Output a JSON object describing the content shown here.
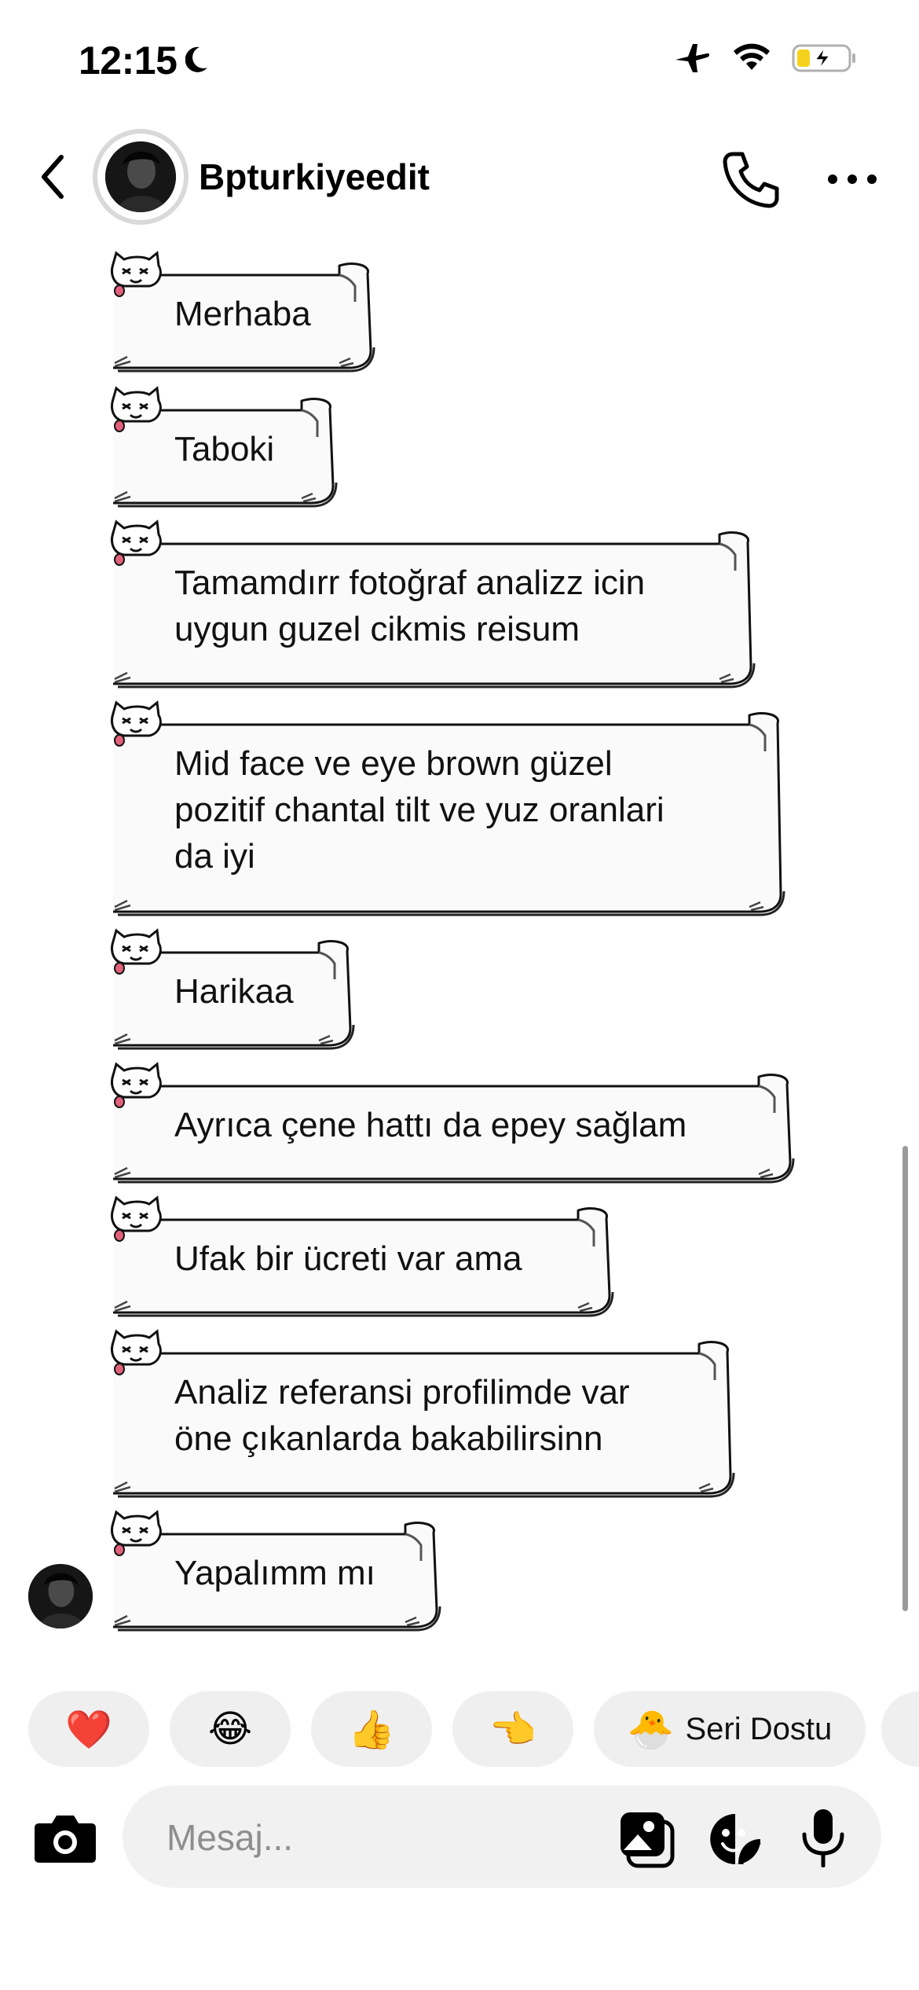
{
  "status_bar": {
    "time": "12:15",
    "icons": [
      "moon-icon",
      "airplane-icon",
      "wifi-icon",
      "battery-charging-icon"
    ],
    "battery_color": "#f5d21b"
  },
  "header": {
    "username": "Bpturkiyeedit",
    "icons": [
      "chevron-left-icon",
      "phone-icon",
      "more-horizontal-icon"
    ]
  },
  "messages": [
    {
      "text": "Merhaba"
    },
    {
      "text": "Taboki"
    },
    {
      "text": "Tamamdırr fotoğraf analizz icin\nuygun guzel cikmis reisum"
    },
    {
      "text": "Mid face ve eye brown güzel\npozitif chantal tilt ve yuz oranlari\nda iyi"
    },
    {
      "text": "Harikaa"
    },
    {
      "text": "Ayrıca çene hattı da epey sağlam"
    },
    {
      "text": "Ufak bir ücreti var ama"
    },
    {
      "text": "Analiz referansi profilimde var\nöne çıkanlarda bakabilirsinn"
    },
    {
      "text": "Yapalımm mı"
    }
  ],
  "quick_reactions": [
    {
      "emoji": "❤️",
      "label": ""
    },
    {
      "emoji": "😂",
      "label": ""
    },
    {
      "emoji": "👍",
      "label": ""
    },
    {
      "emoji": "👈",
      "label": ""
    },
    {
      "emoji": "🐣",
      "label": "Seri Dostu"
    }
  ],
  "composer": {
    "placeholder": "Mesaj...",
    "icons": [
      "camera-icon",
      "gallery-icon",
      "sticker-icon",
      "microphone-icon"
    ]
  },
  "colors": {
    "bubble_fill": "#fafafa",
    "bubble_stroke": "#111111",
    "chip_bg": "#efefef",
    "composer_bg": "#f1f1f1"
  }
}
